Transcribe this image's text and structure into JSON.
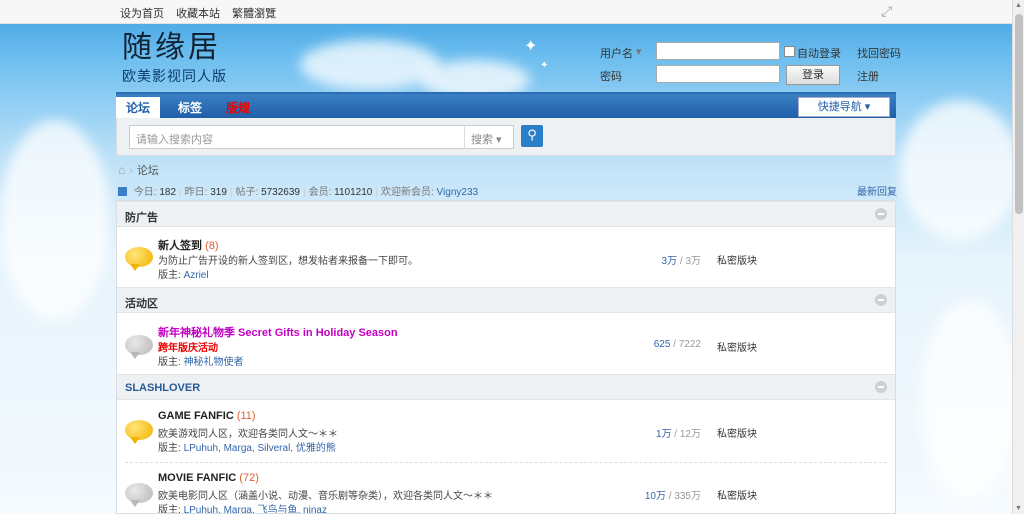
{
  "topbar": {
    "links": [
      "设为首页",
      "收藏本站",
      "繁體瀏覽"
    ]
  },
  "logo": {
    "title": "随缘居",
    "subtitle": "欧美影视同人版"
  },
  "login": {
    "username_label": "用户名",
    "password_label": "密码",
    "remember_label": "自动登录",
    "forgot_label": "找回密码",
    "login_button": "登录",
    "register_label": "注册",
    "username_value": "",
    "password_value": ""
  },
  "nav": {
    "tabs": [
      {
        "label": "论坛"
      },
      {
        "label": "标签"
      },
      {
        "label": "版规"
      }
    ],
    "quick_nav": "快捷导航 ▾"
  },
  "search": {
    "placeholder": "请输入搜索内容",
    "scope": "搜索 ▾"
  },
  "breadcrumb": {
    "current": "论坛"
  },
  "stats": {
    "today_label": "今日:",
    "today": "182",
    "yesterday_label": "昨日:",
    "yesterday": "319",
    "posts_label": "帖子:",
    "posts": "5732639",
    "members_label": "会员:",
    "members": "1101210",
    "welcome_label": "欢迎新会员:",
    "newest_member": "Vigny233",
    "latest_replies": "最新回复"
  },
  "categories": [
    {
      "title": "防广告",
      "forums": [
        {
          "name": "新人签到",
          "count": "(8)",
          "desc": "为防止广告开设的新人签到区，想发帖者来报备一下即可。",
          "mod_label": "版主:",
          "mods": "Azriel",
          "threads": "3万",
          "posts": "3万",
          "access": "私密版块"
        }
      ]
    },
    {
      "title": "活动区",
      "forums": [
        {
          "name": "新年神秘礼物季 Secret Gifts in Holiday Season",
          "desc": "跨年版庆活动",
          "mod_label": "版主:",
          "mods": "神秘礼物使者",
          "threads": "625",
          "posts": "7222",
          "access": "私密版块"
        }
      ]
    },
    {
      "title": "SLASHLOVER",
      "forums": [
        {
          "name": "GAME FANFIC",
          "count": "(11)",
          "desc": "欧美游戏同人区，欢迎各类同人文～＊＊",
          "mod_label": "版主:",
          "mods": "LPuhuh, Marga, Silveral, 优雅的熊",
          "threads": "1万",
          "posts": "12万",
          "access": "私密版块"
        },
        {
          "name": "MOVIE FANFIC",
          "count": "(72)",
          "desc": "欧美电影同人区（涵盖小说、动漫、音乐剧等杂类），欢迎各类同人文～＊＊",
          "mod_label": "版主:",
          "mods": "LPuhuh, Marga, 飞鸟与鱼, ninaz",
          "threads": "10万",
          "posts": "335万",
          "access": "私密版块"
        }
      ]
    }
  ]
}
